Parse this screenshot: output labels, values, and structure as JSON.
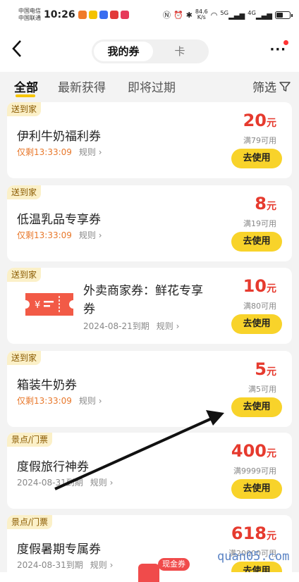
{
  "status_bar": {
    "carrier1": "中国电信",
    "carrier2": "中国联通",
    "time": "10:26",
    "net_speed_value": "84.6",
    "net_speed_unit": "K/s",
    "signal1": "5G",
    "signal2": "4G"
  },
  "header": {
    "back_icon": "chevron-left-icon",
    "tab_active": "我的券",
    "tab_inactive": "卡",
    "more_icon": "more-dots-icon"
  },
  "filters": {
    "tabs": [
      "全部",
      "最新获得",
      "即将过期"
    ],
    "active_index": 0,
    "filter_label": "筛选",
    "filter_icon": "funnel-icon"
  },
  "coupons": [
    {
      "tag": "送到家",
      "title": "伊利牛奶福利券",
      "countdown": "仅剩13:33:09",
      "rule": "规则 ›",
      "price": "20",
      "unit": "元",
      "condition": "满79可用",
      "button": "去使用"
    },
    {
      "tag": "送到家",
      "title": "低温乳品专享券",
      "countdown": "仅剩13:33:09",
      "rule": "规则 ›",
      "price": "8",
      "unit": "元",
      "condition": "满19可用",
      "button": "去使用"
    },
    {
      "tag": "送到家",
      "title": "外卖商家券：鲜花专享券",
      "expire": "2024-08-21到期",
      "rule": "规则 ›",
      "price": "10",
      "unit": "元",
      "condition": "满80可用",
      "button": "去使用",
      "ticket_icon_text": "¥"
    },
    {
      "tag": "送到家",
      "title": "箱装牛奶券",
      "countdown": "仅剩13:33:09",
      "rule": "规则 ›",
      "price": "5",
      "unit": "元",
      "condition": "满5可用",
      "button": "去使用"
    },
    {
      "tag": "景点/门票",
      "title": "度假旅行神券",
      "expire": "2024-08-31到期",
      "rule": "规则 ›",
      "price": "400",
      "unit": "元",
      "condition": "满9999可用",
      "button": "去使用"
    },
    {
      "tag": "景点/门票",
      "title": "度假暑期专属券",
      "expire": "2024-08-31到期",
      "rule": "规则 ›",
      "price": "618",
      "unit": "元",
      "condition": "满20000可用",
      "button": "去使用"
    }
  ],
  "bottom": {
    "cash_badge": "现金券"
  },
  "watermark": "quan05.com",
  "colors": {
    "accent_yellow": "#f8d32a",
    "price_red": "#e63a2e",
    "countdown_orange": "#e8782b",
    "tag_bg": "#fbf0c8"
  }
}
